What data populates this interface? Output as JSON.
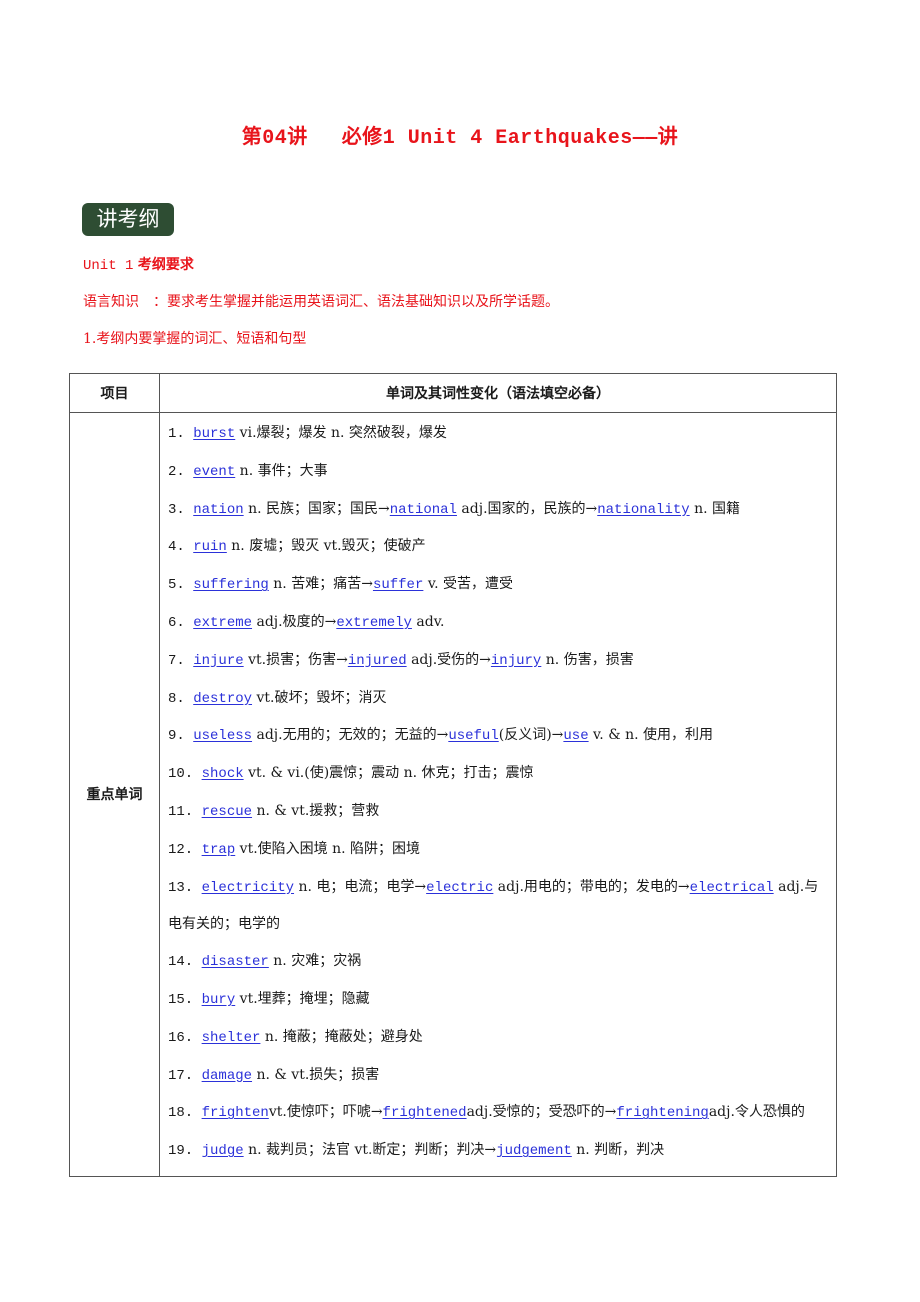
{
  "title": {
    "lecture": "第04讲",
    "main": "必修1 Unit 4 Earthquakes——讲"
  },
  "section_badge": "讲考纲",
  "unit_heading": {
    "prefix": "Unit 1",
    "label": "考纲要求"
  },
  "language_knowledge": "语言知识　：要求考生掌握并能运用英语词汇、语法基础知识以及所学话题。",
  "syllabus_item": "1.考纲内要掌握的词汇、短语和句型",
  "table": {
    "headers": [
      "项目",
      "单词及其词性变化（语法填空必备）"
    ],
    "row_label": "重点单词",
    "entries": [
      {
        "num": "1.",
        "parts": [
          {
            "w": "burst"
          },
          {
            "t": " vi.爆裂；爆发 n. 突然破裂，爆发"
          }
        ]
      },
      {
        "num": "2.",
        "parts": [
          {
            "w": "event"
          },
          {
            "t": " n. 事件；大事"
          }
        ]
      },
      {
        "num": "3.",
        "parts": [
          {
            "w": "nation"
          },
          {
            "t": " n. 民族；国家；国民→"
          },
          {
            "w": "national"
          },
          {
            "t": " adj.国家的，民族的→"
          },
          {
            "w": "nationality"
          },
          {
            "t": " n. 国籍"
          }
        ]
      },
      {
        "num": "4.",
        "parts": [
          {
            "w": "ruin"
          },
          {
            "t": " n. 废墟；毁灭 vt.毁灭；使破产"
          }
        ]
      },
      {
        "num": "5.",
        "parts": [
          {
            "w": "suffering"
          },
          {
            "t": " n. 苦难；痛苦→"
          },
          {
            "w": "suffer"
          },
          {
            "t": " v. 受苦，遭受"
          }
        ]
      },
      {
        "num": "6.",
        "parts": [
          {
            "w": "extreme"
          },
          {
            "t": " adj.极度的→"
          },
          {
            "w": "extremely"
          },
          {
            "t": " adv."
          }
        ]
      },
      {
        "num": "7.",
        "parts": [
          {
            "w": "injure"
          },
          {
            "t": " vt.损害；伤害→"
          },
          {
            "w": "injured"
          },
          {
            "t": " adj.受伤的→"
          },
          {
            "w": "injury"
          },
          {
            "t": " n. 伤害，损害"
          }
        ]
      },
      {
        "num": "8.",
        "parts": [
          {
            "w": "destroy"
          },
          {
            "t": " vt.破坏；毁坏；消灭"
          }
        ]
      },
      {
        "num": "9.",
        "parts": [
          {
            "w": "useless"
          },
          {
            "t": " adj.无用的；无效的；无益的→"
          },
          {
            "w": "useful"
          },
          {
            "t": "(反义词)→"
          },
          {
            "w": "use"
          },
          {
            "t": " v. & n. 使用，利用"
          }
        ]
      },
      {
        "num": "10.",
        "parts": [
          {
            "w": "shock"
          },
          {
            "t": " vt. & vi.(使)震惊；震动 n. 休克；打击；震惊"
          }
        ]
      },
      {
        "num": "11.",
        "parts": [
          {
            "w": "rescue"
          },
          {
            "t": " n. & vt.援救；营救"
          }
        ]
      },
      {
        "num": "12.",
        "parts": [
          {
            "w": "trap"
          },
          {
            "t": " vt.使陷入困境 n. 陷阱；困境"
          }
        ]
      },
      {
        "num": "13.",
        "parts": [
          {
            "w": "electricity"
          },
          {
            "t": " n. 电；电流；电学→"
          },
          {
            "w": "electric"
          },
          {
            "t": " adj.用电的；带电的；发电的→"
          },
          {
            "w": "electrical"
          },
          {
            "t": " adj.与电有关的；电学的"
          }
        ]
      },
      {
        "num": "14.",
        "parts": [
          {
            "w": "disaster"
          },
          {
            "t": " n. 灾难；灾祸"
          }
        ]
      },
      {
        "num": "15.",
        "parts": [
          {
            "w": "bury"
          },
          {
            "t": " vt.埋葬；掩埋；隐藏"
          }
        ]
      },
      {
        "num": "16.",
        "parts": [
          {
            "w": "shelter"
          },
          {
            "t": " n. 掩蔽；掩蔽处；避身处"
          }
        ]
      },
      {
        "num": "17.",
        "parts": [
          {
            "w": "damage"
          },
          {
            "t": " n. & vt.损失；损害"
          }
        ]
      },
      {
        "num": "18.",
        "parts": [
          {
            "w": "frighten"
          },
          {
            "t": "vt.使惊吓；吓唬→"
          },
          {
            "w": "frightened"
          },
          {
            "t": "adj.受惊的；受恐吓的→"
          },
          {
            "w": "frightening"
          },
          {
            "t": "adj.令人恐惧的"
          }
        ]
      },
      {
        "num": "19.",
        "parts": [
          {
            "w": "judge"
          },
          {
            "t": " n. 裁判员；法官 vt.断定；判断；判决→"
          },
          {
            "w": "judgement"
          },
          {
            "t": " n. 判断，判决"
          }
        ]
      }
    ]
  },
  "colors": {
    "title_red": "#e8141b",
    "link_blue": "#2b31d9",
    "badge_green": "#2e4d33"
  }
}
